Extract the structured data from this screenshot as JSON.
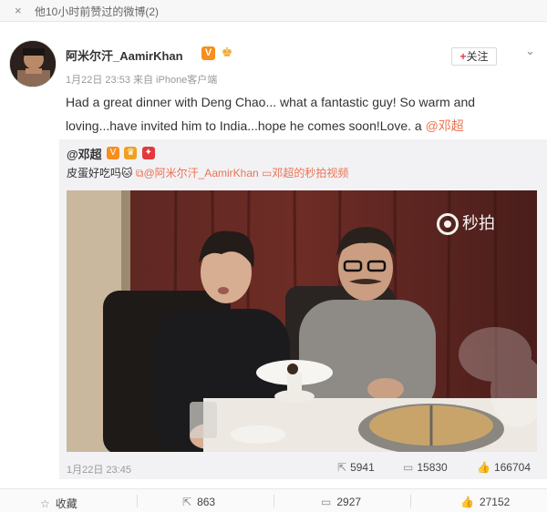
{
  "notice": {
    "close": "×",
    "text": "他10小时前赞过的微博(2)"
  },
  "post": {
    "author": "阿米尔汗_AamirKhan",
    "badge_v": "V",
    "badge_crown": "♚",
    "follow_label": "关注",
    "follow_plus": "+",
    "menu_chevron": "⌄",
    "meta": "1月22日 23:53 来自 iPhone客户端",
    "text": "Had a great dinner with Deng Chao... what a fantastic guy! So warm and loving...have invited him to India...hope he comes soon!Love. a",
    "mention": "@邓超"
  },
  "repost": {
    "author": "@邓超",
    "text": "皮蛋好吃吗",
    "emoji": "🐱",
    "link_mention": "@阿米尔汗_AamirKhan",
    "video_link": "邓超的秒拍视频",
    "watermark": "秒拍",
    "date": "1月22日 23:45",
    "stats": {
      "reposts": "5941",
      "comments": "15830",
      "likes": "166704"
    }
  },
  "actions": {
    "favorite": "收藏",
    "repost": "863",
    "comment": "2927",
    "like": "27152"
  },
  "colors": {
    "accent": "#eb7350",
    "badge_orange": "#f78e1e",
    "follow_plus": "#e2383a"
  },
  "icons": {
    "close": "close-icon",
    "repost": "repost-icon",
    "comment": "comment-icon",
    "like": "like-icon",
    "star": "star-icon",
    "link": "link-icon",
    "video": "video-icon"
  }
}
